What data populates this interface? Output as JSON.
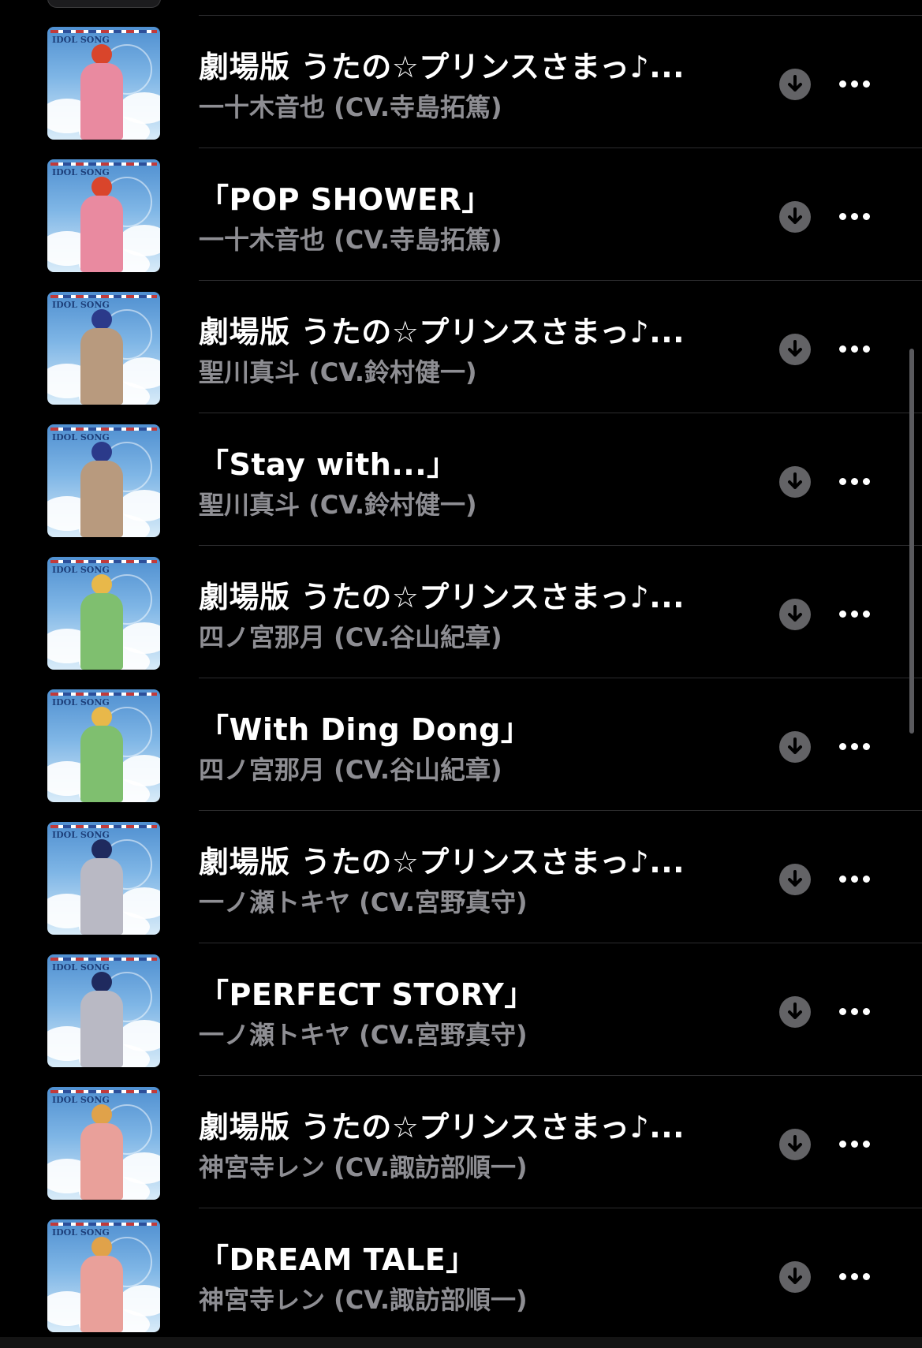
{
  "colors": {
    "background": "#000000",
    "title": "#ffffff",
    "subtitle": "#8e8e93",
    "divider": "#2c2c2e",
    "download_button": "#636366"
  },
  "icons": {
    "download": "arrow-down-circle-icon",
    "more": "ellipsis-icon"
  },
  "tracks": [
    {
      "title": "劇場版 うたの☆プリンスさまっ♪...",
      "artist": "一十木音也 (CV.寺島拓篤)",
      "artwork_label": "IDOL SONG"
    },
    {
      "title": "「POP SHOWER」",
      "artist": "一十木音也 (CV.寺島拓篤)",
      "artwork_label": "IDOL SONG"
    },
    {
      "title": "劇場版 うたの☆プリンスさまっ♪...",
      "artist": "聖川真斗 (CV.鈴村健一)",
      "artwork_label": "IDOL SONG"
    },
    {
      "title": "「Stay with...」",
      "artist": "聖川真斗 (CV.鈴村健一)",
      "artwork_label": "IDOL SONG"
    },
    {
      "title": "劇場版 うたの☆プリンスさまっ♪...",
      "artist": "四ノ宮那月 (CV.谷山紀章)",
      "artwork_label": "IDOL SONG"
    },
    {
      "title": "「With Ding Dong」",
      "artist": "四ノ宮那月 (CV.谷山紀章)",
      "artwork_label": "IDOL SONG"
    },
    {
      "title": "劇場版 うたの☆プリンスさまっ♪...",
      "artist": "一ノ瀬トキヤ (CV.宮野真守)",
      "artwork_label": "IDOL SONG"
    },
    {
      "title": "「PERFECT STORY」",
      "artist": "一ノ瀬トキヤ (CV.宮野真守)",
      "artwork_label": "IDOL SONG"
    },
    {
      "title": "劇場版 うたの☆プリンスさまっ♪...",
      "artist": "神宮寺レン (CV.諏訪部順一)",
      "artwork_label": "IDOL SONG"
    },
    {
      "title": "「DREAM TALE」",
      "artist": "神宮寺レン (CV.諏訪部順一)",
      "artwork_label": "IDOL SONG"
    }
  ]
}
